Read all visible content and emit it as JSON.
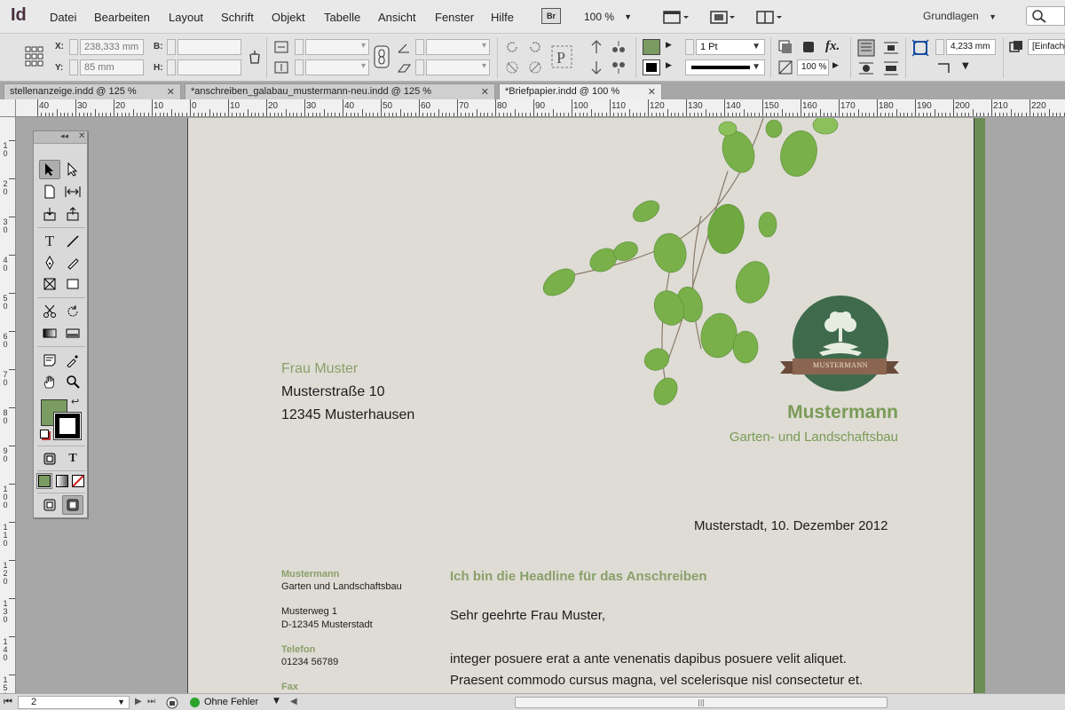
{
  "app": {
    "logo": "Id",
    "menu": [
      "Datei",
      "Bearbeiten",
      "Layout",
      "Schrift",
      "Objekt",
      "Tabelle",
      "Ansicht",
      "Fenster",
      "Hilfe"
    ],
    "bridge_badge": "Br",
    "zoom": "100 %",
    "workspace": "Grundlagen"
  },
  "control": {
    "x_label": "X:",
    "x_value": "238,333 mm",
    "y_label": "Y:",
    "y_value": "85 mm",
    "w_label": "B:",
    "h_label": "H:",
    "stroke_weight": "1 Pt",
    "opacity": "100 %",
    "offset_value": "4,233 mm",
    "style_name": "[Einfache"
  },
  "tabs": [
    {
      "label": "stellenanzeige.indd @ 125 %",
      "active": false
    },
    {
      "label": "*anschreiben_galabau_mustermann-neu.indd @ 125 %",
      "active": false
    },
    {
      "label": "*Briefpapier.indd @ 100 %",
      "active": true
    }
  ],
  "ruler": {
    "h_labels": [
      "40",
      "30",
      "20",
      "10",
      "0",
      "10",
      "20",
      "30",
      "40",
      "50",
      "60",
      "70",
      "80",
      "90",
      "100",
      "110",
      "120",
      "130",
      "140",
      "150",
      "160",
      "170",
      "180",
      "190",
      "200",
      "210",
      "220",
      "230"
    ],
    "v_labels": [
      "1\n0",
      "2\n0",
      "3\n0",
      "4\n0",
      "5\n0",
      "6\n0",
      "7\n0",
      "8\n0",
      "9\n0",
      "1\n0\n0",
      "1\n1\n0",
      "1\n2\n0",
      "1\n3\n0",
      "1\n4\n0",
      "1\n5\n0"
    ]
  },
  "letter": {
    "recipient_name": "Frau Muster",
    "recipient_street": "Musterstraße 10",
    "recipient_city": "12345 Musterhausen",
    "logo_banner_text": "MUSTERMANN",
    "brand_name": "Mustermann",
    "brand_subtitle": "Garten- und Landschaftsbau",
    "date": "Musterstadt, 10. Dezember 2012",
    "sidebar": {
      "company": "Mustermann",
      "company_sub": "Garten und Landschaftsbau",
      "street": "Musterweg 1",
      "city": "D-12345 Musterstadt",
      "phone_label": "Telefon",
      "phone": "01234 56789",
      "fax_label": "Fax"
    },
    "headline": "Ich bin die Headline für das Anschreiben",
    "salutation": "Sehr geehrte Frau Muster,",
    "body_line1": "integer posuere erat a ante venenatis dapibus posuere velit aliquet.",
    "body_line2": "Praesent commodo cursus magna, vel scelerisque nisl consectetur et."
  },
  "status": {
    "page": "2",
    "preflight": "Ohne Fehler"
  },
  "colors": {
    "accent_green": "#7a9b56",
    "fill_swatch": "#7a9b62",
    "logo_dark_green": "#3f6b4c",
    "page_bg": "#dedcd5"
  }
}
